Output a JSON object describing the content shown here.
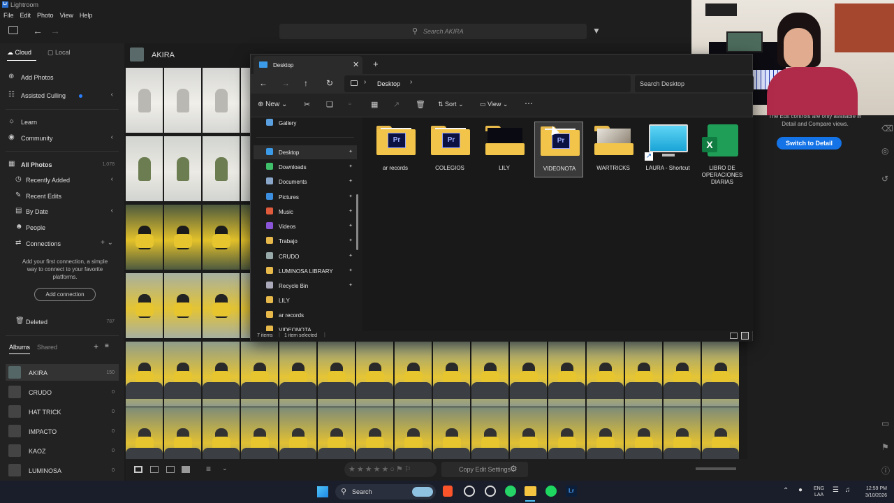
{
  "app": {
    "title": "Lightroom"
  },
  "menu": [
    "File",
    "Edit",
    "Photo",
    "View",
    "Help"
  ],
  "search": {
    "placeholder": "Search AKIRA"
  },
  "left": {
    "tabs": {
      "cloud": "Cloud",
      "local": "Local"
    },
    "add_photos": "Add Photos",
    "assisted_culling": "Assisted Culling",
    "learn": "Learn",
    "community": "Community",
    "all_photos": "All Photos",
    "all_photos_count": "1,078",
    "recently_added": "Recently Added",
    "recent_edits": "Recent Edits",
    "by_date": "By Date",
    "people": "People",
    "connections": "Connections",
    "connect_hint": "Add your first connection, a simple way to connect to your favorite platforms.",
    "add_connection": "Add connection",
    "deleted": "Deleted",
    "deleted_count": "787",
    "albums_tab": "Albums",
    "shared_tab": "Shared",
    "albums": [
      {
        "name": "AKIRA",
        "count": "150"
      },
      {
        "name": "CRUDO",
        "count": "0"
      },
      {
        "name": "HAT TRICK",
        "count": "0"
      },
      {
        "name": "IMPACTO",
        "count": "0"
      },
      {
        "name": "KAOZ",
        "count": "0"
      },
      {
        "name": "LUMINOSA",
        "count": "0"
      }
    ]
  },
  "grid": {
    "album_title": "AKIRA"
  },
  "bottom": {
    "copy_edit": "Copy Edit Settings"
  },
  "right": {
    "notice": "The Edit controls are only available in Detail and Compare views.",
    "switch_button": "Switch to Detail"
  },
  "explorer": {
    "tab_title": "Desktop",
    "breadcrumb": "Desktop",
    "search_placeholder": "Search Desktop",
    "cmd": {
      "new": "New",
      "sort": "Sort",
      "view": "View"
    },
    "nav": [
      {
        "label": "Gallery",
        "icon": "gallery-icon",
        "color": "#5aa0e0",
        "pinned": false
      },
      {
        "label": "Desktop",
        "icon": "desktop-icon",
        "color": "#3c9be8",
        "pinned": true
      },
      {
        "label": "Downloads",
        "icon": "download-icon",
        "color": "#3fbf6a",
        "pinned": true
      },
      {
        "label": "Documents",
        "icon": "document-icon",
        "color": "#8aa7c9",
        "pinned": true
      },
      {
        "label": "Pictures",
        "icon": "picture-icon",
        "color": "#3c8fe0",
        "pinned": true
      },
      {
        "label": "Music",
        "icon": "music-icon",
        "color": "#e05a3c",
        "pinned": true
      },
      {
        "label": "Videos",
        "icon": "video-icon",
        "color": "#8a54d6",
        "pinned": true
      },
      {
        "label": "Trabajo",
        "icon": "folder-icon",
        "color": "#e7b84a",
        "pinned": true
      },
      {
        "label": "CRUDO",
        "icon": "drive-icon",
        "color": "#9aa",
        "pinned": true
      },
      {
        "label": "LUMINOSA LIBRARY",
        "icon": "folder-icon",
        "color": "#e7b84a",
        "pinned": true
      },
      {
        "label": "Recycle Bin",
        "icon": "recycle-bin-icon",
        "color": "#aab",
        "pinned": true
      },
      {
        "label": "LILY",
        "icon": "folder-icon",
        "color": "#e7b84a",
        "pinned": false
      },
      {
        "label": "ar records",
        "icon": "folder-icon",
        "color": "#e7b84a",
        "pinned": false
      },
      {
        "label": "VIDEONOTA",
        "icon": "folder-icon",
        "color": "#e7b84a",
        "pinned": false
      }
    ],
    "items": [
      {
        "name": "ar records",
        "kind": "pr-folder"
      },
      {
        "name": "COLEGIOS",
        "kind": "pr-folder"
      },
      {
        "name": "LILY",
        "kind": "dark-folder"
      },
      {
        "name": "VIDEONOTA",
        "kind": "pr-folder-selected"
      },
      {
        "name": "WARTRICKS",
        "kind": "photo-folder"
      },
      {
        "name": "LAURA - Shortcut",
        "kind": "shortcut"
      },
      {
        "name": "LIBRO DE OPERACIONES DIARIAS",
        "kind": "excel"
      }
    ],
    "status": {
      "items": "7 items",
      "selected": "1 item selected"
    }
  },
  "taskbar": {
    "search": "Search",
    "lang": "ENG",
    "lang2": "LAA",
    "time": "12:59 PM",
    "date": "3/10/2026"
  }
}
